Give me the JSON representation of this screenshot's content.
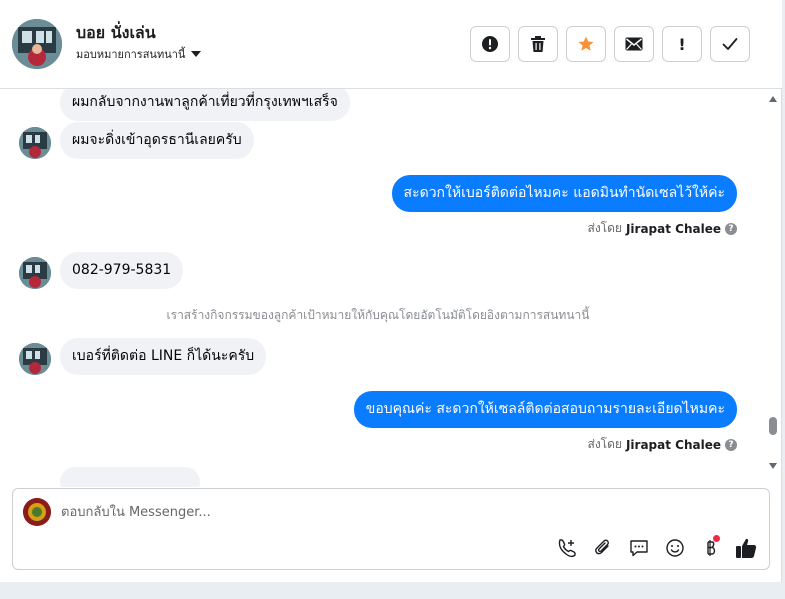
{
  "header": {
    "contact_name": "บอย นั่งเล่น",
    "assignment_label": "มอบหมายการสนทนานี้"
  },
  "actions": [
    {
      "icon": "alert-circle-icon",
      "name": "mark-spam-button"
    },
    {
      "icon": "trash-icon",
      "name": "delete-button"
    },
    {
      "icon": "star-icon",
      "name": "star-button"
    },
    {
      "icon": "envelope-icon",
      "name": "mark-unread-button"
    },
    {
      "icon": "exclamation-icon",
      "name": "follow-up-button",
      "label": "!"
    },
    {
      "icon": "checkmark-icon",
      "name": "mark-done-button"
    }
  ],
  "messages": [
    {
      "direction": "in",
      "text": "ผมกลับจากงานพาลูกค้าเที่ยวที่กรุงเทพฯเสร็จ"
    },
    {
      "direction": "in",
      "text": "ผมจะดิ่งเข้าอุดรธานีเลยครับ"
    },
    {
      "direction": "out",
      "text": "สะดวกให้เบอร์ติดต่อไหมคะ แอดมินทำนัดเซลไว้ให้ค่ะ",
      "sent_by_prefix": "ส่งโดย",
      "sent_by": "Jirapat Chalee"
    },
    {
      "direction": "in",
      "text": "082-979-5831"
    },
    {
      "direction": "system",
      "text": "เราสร้างกิจกรรมของลูกค้าเป้าหมายให้กับคุณโดยอัตโนมัติโดยอิงตามการสนทนานี้"
    },
    {
      "direction": "in",
      "text": "เบอร์ที่ติดต่อ LINE ก็ได้นะครับ"
    },
    {
      "direction": "out",
      "text": "ขอบคุณค่ะ สะดวกให้เซลล์ติดต่อสอบถามรายละเอียดไหมคะ",
      "sent_by_prefix": "ส่งโดย",
      "sent_by": "Jirapat Chalee"
    }
  ],
  "composer": {
    "placeholder": "ตอบกลับใน Messenger...",
    "tools": [
      "phone-add-icon",
      "paperclip-icon",
      "chat-bubble-icon",
      "emoji-icon",
      "baht-icon",
      "thumbs-up-icon"
    ]
  },
  "colors": {
    "outgoing_bubble": "#0a7cff",
    "incoming_bubble": "#f0f2f5",
    "star_accent": "#f7923a",
    "notification_dot": "#f02849"
  }
}
